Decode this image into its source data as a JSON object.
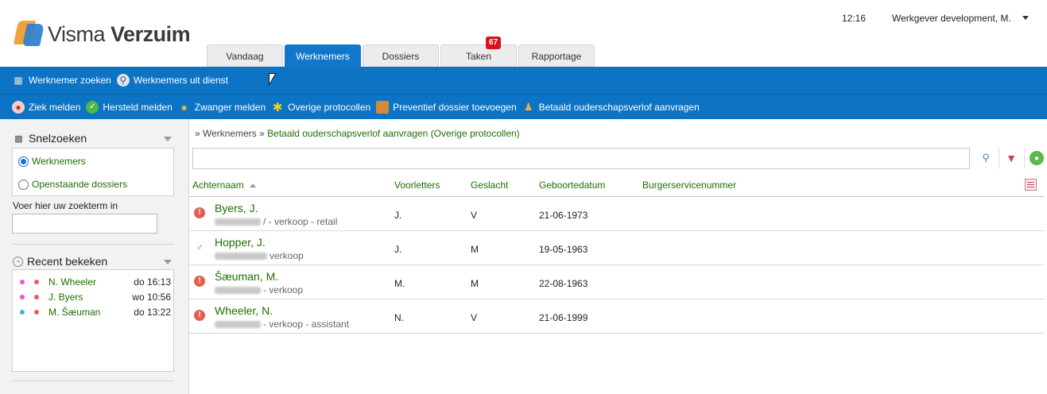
{
  "header": {
    "logo_light": "Visma ",
    "logo_bold": "Verzuim",
    "time": "12:16",
    "user": "Werkgever development, M."
  },
  "tabs": [
    {
      "label": "Vandaag",
      "active": false
    },
    {
      "label": "Werknemers",
      "active": true
    },
    {
      "label": "Dossiers",
      "active": false
    },
    {
      "label": "Taken",
      "active": false,
      "badge": "67"
    },
    {
      "label": "Rapportage",
      "active": false
    }
  ],
  "toolbar1": [
    {
      "label": "Werknemer zoeken",
      "icon": "employees-icon"
    },
    {
      "label": "Werknemers uit dienst",
      "icon": "search-out-of-service-icon"
    }
  ],
  "toolbar2": [
    {
      "label": "Ziek melden",
      "icon": "pill-icon"
    },
    {
      "label": "Hersteld melden",
      "icon": "check-icon"
    },
    {
      "label": "Zwanger melden",
      "icon": "pregnant-icon"
    },
    {
      "label": "Overige protocollen",
      "icon": "protocol-icon"
    },
    {
      "label": "Preventief dossier toevoegen",
      "icon": "folder-icon"
    },
    {
      "label": "Betaald ouderschapsverlof aanvragen",
      "icon": "parental-leave-icon"
    }
  ],
  "sidebar": {
    "quicksearch_title": "Snelzoeken",
    "radio_employees": "Werknemers",
    "radio_open_files": "Openstaande dossiers",
    "search_label": "Voer hier uw zoekterm in",
    "recent_title": "Recent bekeken",
    "recent": [
      {
        "name": "N. Wheeler",
        "time": "do 16:13",
        "dot1": "#e05ad0",
        "dot2": "#e06060"
      },
      {
        "name": "J. Byers",
        "time": "wo 10:56",
        "dot1": "#e05ad0",
        "dot2": "#e06060"
      },
      {
        "name": "M. Šæuman",
        "time": "do 13:22",
        "dot1": "#4ab0e0",
        "dot2": "#e06060"
      }
    ]
  },
  "breadcrumb": {
    "root": "» Werknemers »",
    "current": "Betaald ouderschapsverlof aanvragen (Overige protocollen)"
  },
  "table": {
    "columns": [
      "Achternaam",
      "Voorletters",
      "Geslacht",
      "Geboortedatum",
      "Burgerservicenummer"
    ],
    "rows": [
      {
        "name": "Byers, J.",
        "sub": "/ - verkoop - retail",
        "initials": "J.",
        "gender": "V",
        "dob": "21-06-1973",
        "status": "alert-icon"
      },
      {
        "name": "Hopper, J.",
        "sub": "verkoop",
        "initials": "J.",
        "gender": "M",
        "dob": "19-05-1963",
        "status": "male-icon"
      },
      {
        "name": "Šæuman, M.",
        "sub": "- verkoop",
        "initials": "M.",
        "gender": "M",
        "dob": "22-08-1963",
        "status": "alert-icon"
      },
      {
        "name": "Wheeler, N.",
        "sub": "- verkoop - assistant",
        "initials": "N.",
        "gender": "V",
        "dob": "21-06-1999",
        "status": "alert-icon"
      }
    ]
  },
  "colors": {
    "brand_blue": "#0d74c5",
    "link_green": "#1f6e00",
    "badge_red": "#d4141b"
  }
}
